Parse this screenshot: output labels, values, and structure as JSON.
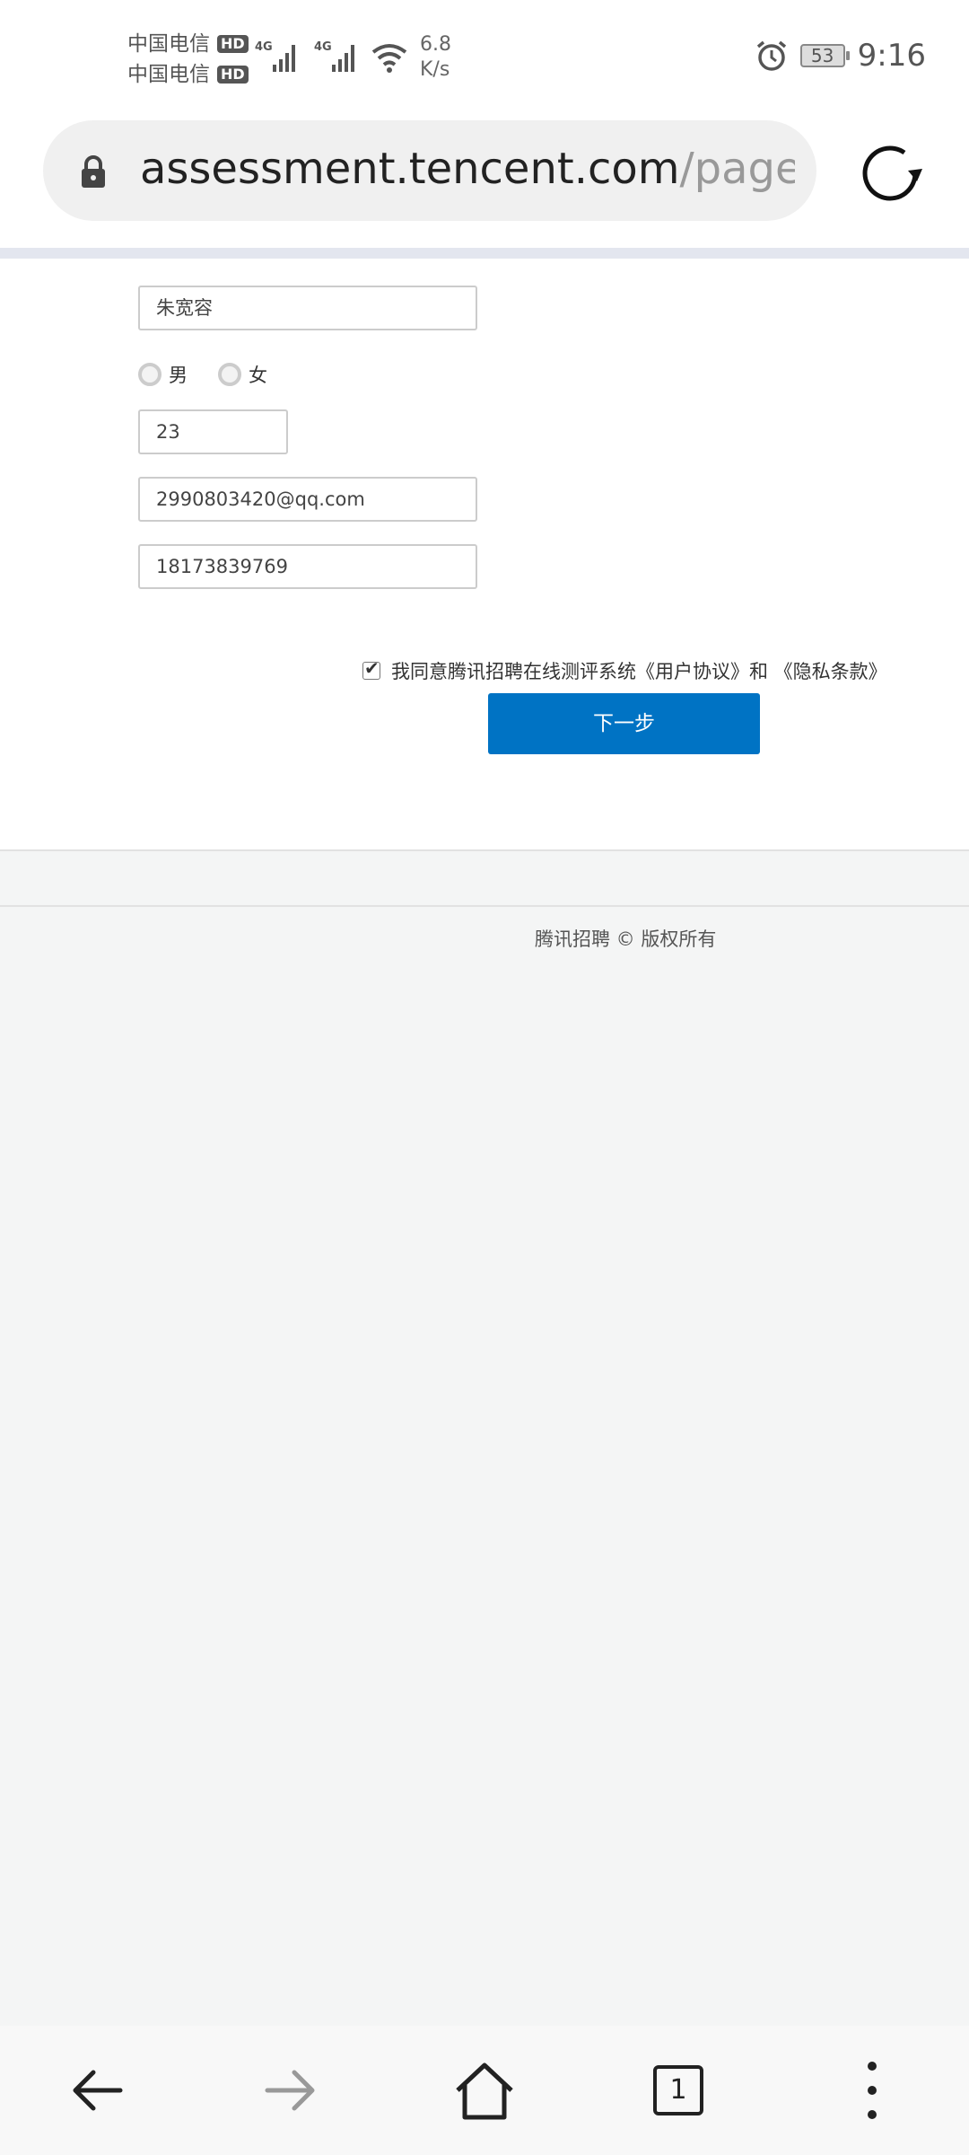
{
  "status_bar": {
    "carrier1": "中国电信",
    "carrier2": "中国电信",
    "hd_badge": "HD",
    "network": "4G",
    "speed_value": "6.8",
    "speed_unit": "K/s",
    "battery": "53",
    "time": "9:16"
  },
  "browser": {
    "url_host": "assessment.tencent.com",
    "url_path": "/pages/p"
  },
  "form": {
    "name_value": "朱宽容",
    "gender_options": [
      "男",
      "女"
    ],
    "age_value": "23",
    "email_value": "2990803420@qq.com",
    "phone_value": "18173839769",
    "agreement_text": "我同意腾讯招聘在线测评系统《用户协议》和 《隐私条款》",
    "agreement_checked": true,
    "next_button": "下一步"
  },
  "footer": {
    "copyright": "腾讯招聘 © 版权所有"
  },
  "bottom_nav": {
    "tab_count": "1"
  },
  "colors": {
    "primary_button": "#0073c4",
    "page_background": "#f4f5f5"
  }
}
